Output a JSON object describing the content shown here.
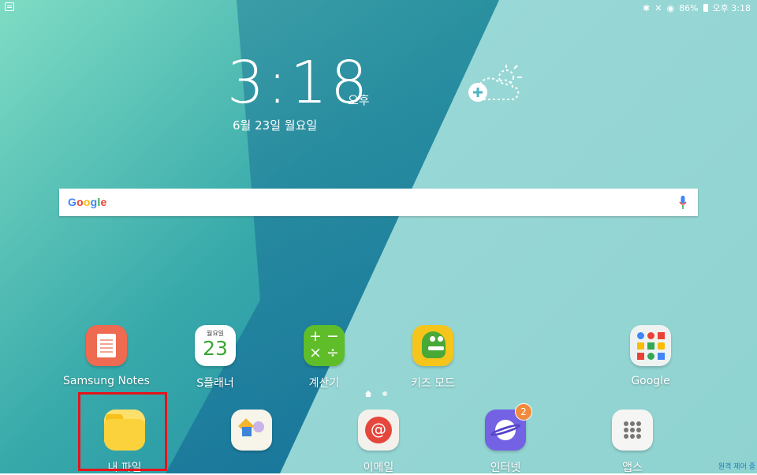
{
  "status_bar": {
    "battery": "86%",
    "time": "오후 3:18"
  },
  "clock": {
    "time": "3:18",
    "ampm": "오후",
    "date": "6월 23일 월요일"
  },
  "search": {
    "logo": "Google"
  },
  "apps": [
    {
      "label": "Samsung Notes"
    },
    {
      "label": "S플래너",
      "icon_day": "월요일",
      "icon_date": "23"
    },
    {
      "label": "계산기"
    },
    {
      "label": "키즈 모드"
    },
    {
      "label": "Google"
    }
  ],
  "dock": [
    {
      "label": "내 파일"
    },
    {
      "label": ""
    },
    {
      "label": "이메일"
    },
    {
      "label": "인터넷",
      "badge": "2"
    },
    {
      "label": "앱스"
    }
  ],
  "overlay_text": "원격 제어 중",
  "colors": {
    "highlight": "#e5131b",
    "badge": "#f08a3c",
    "notes": "#ee6a50",
    "calculator": "#5fbd2a"
  }
}
